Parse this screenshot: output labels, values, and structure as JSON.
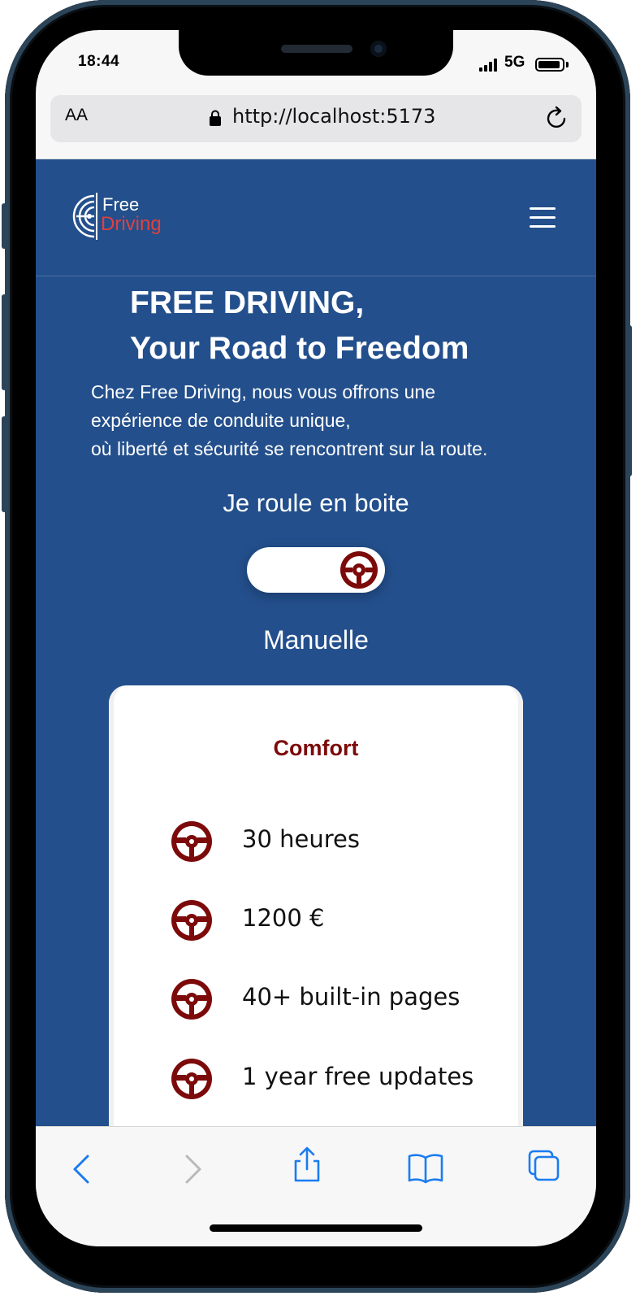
{
  "status_bar": {
    "time": "18:44",
    "network": "5G"
  },
  "browser": {
    "text_size_label": "AA",
    "url": "http://localhost:5173"
  },
  "brand": {
    "line1": "Free",
    "line2": "Driving"
  },
  "hero": {
    "title_line1": "FREE DRIVING,",
    "title_line2": "Your Road to Freedom",
    "text_line1": "Chez Free Driving, nous vous offrons une",
    "text_line2": "expérience de conduite unique,",
    "text_line3": "où liberté et sécurité se rencontrent sur la route."
  },
  "transmission": {
    "prompt": "Je roule en boite",
    "selected": "Manuelle"
  },
  "plan": {
    "name": "Comfort",
    "features": [
      "30 heures",
      "1200 €",
      "40+ built-in pages",
      "1 year free updates"
    ]
  },
  "colors": {
    "page_bg": "#234f8c",
    "accent": "#7c0a0a",
    "logo_red": "#e0413f",
    "toolbar_blue": "#1a7cf0"
  },
  "icons": [
    "signal-icon",
    "battery-icon",
    "lock-icon",
    "reload-icon",
    "menu-icon",
    "steering-wheel-icon",
    "back-icon",
    "forward-icon",
    "share-icon",
    "bookmarks-icon",
    "tabs-icon"
  ]
}
